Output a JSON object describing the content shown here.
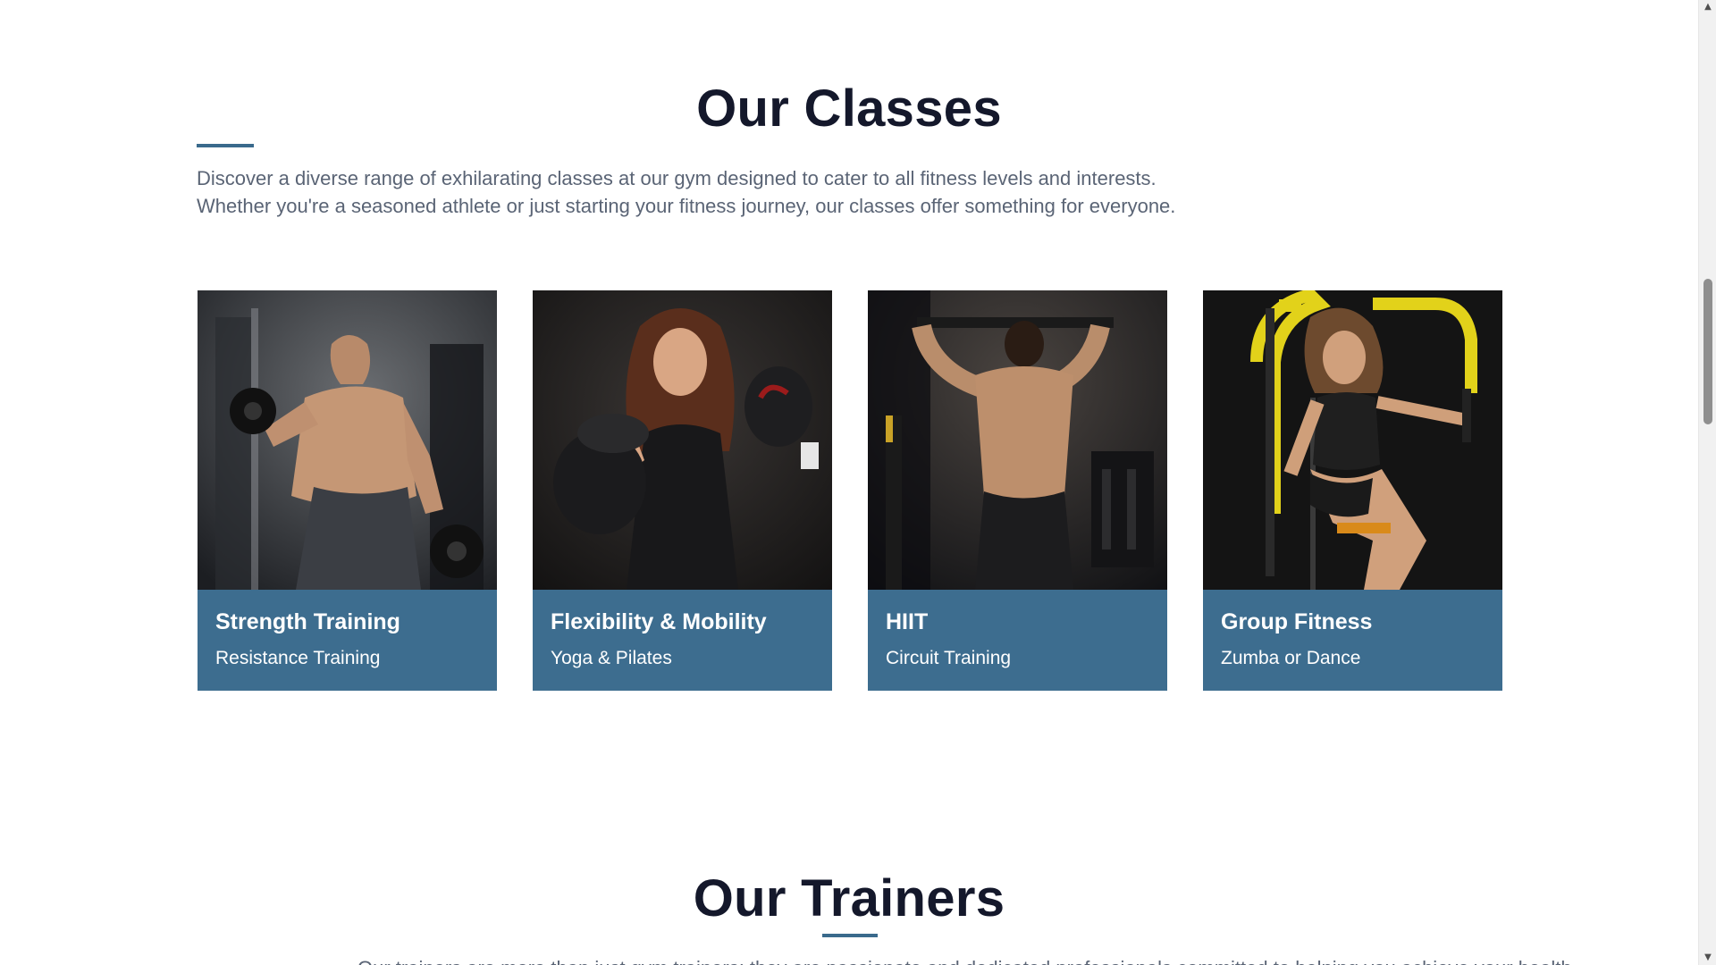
{
  "classes_section": {
    "title": "Our Classes",
    "intro_line1": "Discover a diverse range of exhilarating classes at our gym designed to cater to all fitness levels and interests.",
    "intro_line2": "Whether you're a seasoned athlete or just starting your fitness journey, our classes offer something for everyone.",
    "accent_color": "#3a6a8c",
    "cards": [
      {
        "title": "Strength Training",
        "subtitle": "Resistance Training",
        "image": "man-lifting-dumbbells-photo"
      },
      {
        "title": "Flexibility & Mobility",
        "subtitle": "Yoga & Pilates",
        "image": "woman-with-boxing-gloves-photo"
      },
      {
        "title": "HIIT",
        "subtitle": "Circuit Training",
        "image": "man-doing-pull-ups-photo"
      },
      {
        "title": "Group Fitness",
        "subtitle": "Zumba or Dance",
        "image": "woman-on-chest-press-machine-photo"
      }
    ],
    "card_color": "#3d6d8f"
  },
  "trainers_section": {
    "title": "Our Trainers",
    "intro_partial": "Our trainers are more than just gym trainers; they are passionate and dedicated professionals committed to helping you achieve your health"
  },
  "scrollbar": {
    "up_icon": "triangle-up-icon",
    "down_icon": "triangle-down-icon",
    "scroll_position": 0.3
  }
}
